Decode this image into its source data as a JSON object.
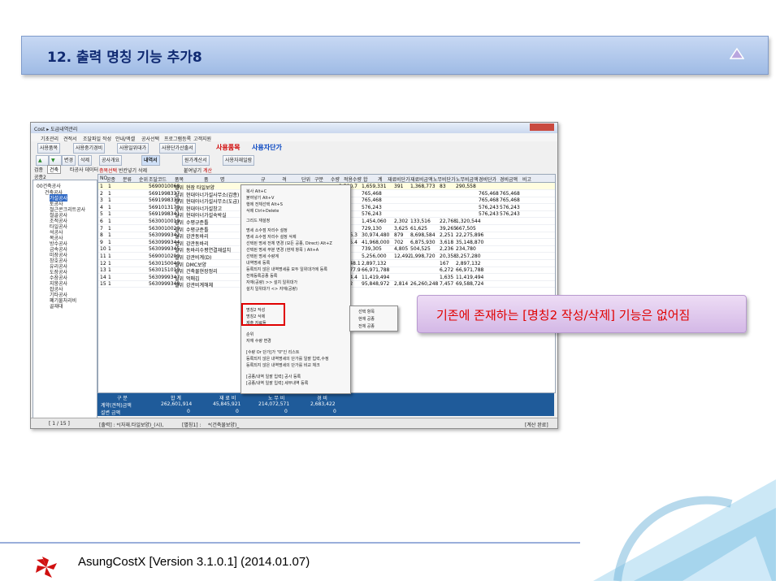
{
  "slide": {
    "title": "12. 출력 명칭 기능 추가8",
    "callout": "기존에 존재하는 [명칭2 작성/삭제] 기능은 없어짐",
    "footer": "AsungCostX    [Version 3.1.0.1]    (2014.01.07)"
  },
  "app": {
    "window_title": "Cost ▸ 도급내역관리",
    "menu": [
      "기초관리",
      "견적서",
      "조달파일 작성",
      "안내/액셀",
      "공사선택",
      "프로그램등록",
      "고객지원"
    ],
    "toolbar": {
      "item1": "사용품목",
      "item2": "사용중기경비",
      "item3": "사용일위대가",
      "item4": "사용단가산출서",
      "red": "사용품목",
      "blue": "사용자단가"
    },
    "toolbar2": {
      "prev": "공사개요",
      "active": "내역서",
      "calc": "원가계산서",
      "docs": "사용자재일람"
    },
    "left_buttons": [
      "변경",
      "삭제"
    ],
    "left_filter": {
      "label": "검종",
      "select": "건축",
      "link": "타공사 데이터"
    },
    "left_label": "공종2",
    "tabs": [
      "층목선택",
      "빈칸넣기",
      "삭제",
      "붙여넣기",
      "계산"
    ],
    "tree_root": "00건축공사",
    "tree_sub": "건축공사",
    "tree": [
      "가설공사",
      "토공사",
      "철근콘크리트공사",
      "철골공사",
      "조적공사",
      "타일공사",
      "석공사",
      "목공사",
      "방수공사",
      "금속공사",
      "미장공사",
      "창호공사",
      "유리공사",
      "도장공사",
      "수장공사",
      "지붕공사",
      "잡공사",
      "기타공사",
      "폐기물처리비",
      "골재대"
    ],
    "grid_headers": [
      "NO",
      "공종",
      "분류",
      "순위",
      "조달코드",
      "품목",
      "품",
      "명",
      "규",
      "격",
      "단위",
      "구분",
      "수량",
      "적용수량",
      "합",
      "계",
      "재료비단가",
      "재료비금액",
      "노무비단가",
      "노무비금액",
      "경비단가",
      "경비금액",
      "비고"
    ],
    "rows": [
      {
        "no": "1",
        "a": "1",
        "code": "5690010068",
        "kind": "일위",
        "name": "현장 타일보양",
        "qty": "3,500.7",
        "amt": "1,659,331",
        "m1": "391",
        "m2": "1,368,773",
        "l1": "83",
        "l2": "290,558",
        "e1": "",
        "e2": ""
      },
      {
        "no": "2",
        "a": "1",
        "code": "5691998337",
        "kind": "일위",
        "name": "현대아너가설사무소(갑종)",
        "qty": "1",
        "amt": "765,468",
        "m1": "",
        "m2": "",
        "l1": "",
        "l2": "",
        "e1": "765,468",
        "e2": "765,468"
      },
      {
        "no": "3",
        "a": "1",
        "code": "5691998339",
        "kind": "일위",
        "name": "현대아너가설사무소(도급)",
        "qty": "1",
        "amt": "765,468",
        "m1": "",
        "m2": "",
        "l1": "",
        "l2": "",
        "e1": "765,468",
        "e2": "765,468"
      },
      {
        "no": "4",
        "a": "1",
        "code": "5691013170",
        "kind": "일위",
        "name": "현대아너가설창고",
        "qty": "1",
        "amt": "576,243",
        "m1": "",
        "m2": "",
        "l1": "",
        "l2": "",
        "e1": "576,243",
        "e2": "576,243"
      },
      {
        "no": "5",
        "a": "1",
        "code": "5691998341",
        "kind": "일위",
        "name": "현대아너가설숙박실",
        "qty": "1",
        "amt": "576,243",
        "m1": "",
        "m2": "",
        "l1": "",
        "l2": "",
        "e1": "576,243",
        "e2": "576,243"
      },
      {
        "no": "6",
        "a": "1",
        "code": "5630010019",
        "kind": "일위",
        "name": "수평규준틀",
        "qty": "58",
        "amt": "1,454,060",
        "m1": "2,302",
        "m2": "133,516",
        "l1": "22,768",
        "l2": "1,320,544",
        "e1": "",
        "e2": ""
      },
      {
        "no": "7",
        "a": "1",
        "code": "5630010020",
        "kind": "일위",
        "name": "수평규준틀",
        "qty": "17",
        "amt": "729,130",
        "m1": "3,625",
        "m2": "61,625",
        "l1": "39,265",
        "l2": "667,505",
        "e1": "",
        "e2": ""
      },
      {
        "no": "8",
        "a": "1",
        "code": "5630999342",
        "kind": "일위",
        "name": "강관동바리",
        "qty": "9,896.3",
        "amt": "30,974,480",
        "m1": "879",
        "m2": "8,698,584",
        "l1": "2,251",
        "l2": "22,275,896",
        "e1": "",
        "e2": ""
      },
      {
        "no": "9",
        "a": "1",
        "code": "5630999344",
        "kind": "일위",
        "name": "강관동바리",
        "qty": "9,775.4",
        "amt": "41,968,000",
        "m1": "702",
        "m2": "6,875,930",
        "l1": "3,618",
        "l2": "35,148,870",
        "e1": "",
        "e2": ""
      },
      {
        "no": "10",
        "a": "1",
        "code": "5630999345",
        "kind": "일위",
        "name": "동바리수평연결재설치",
        "qty": "105",
        "amt": "739,305",
        "m1": "4,805",
        "m2": "504,525",
        "l1": "2,236",
        "l2": "234,780",
        "e1": "",
        "e2": ""
      },
      {
        "no": "11",
        "a": "1",
        "code": "5690010200",
        "kind": "일위",
        "name": "강관비계(D)",
        "qty": "160",
        "amt": "5,256,000",
        "m1": "12,492",
        "m2": "1,998,720",
        "l1": "20,358",
        "l2": "3,257,280",
        "e1": "",
        "e2": ""
      },
      {
        "no": "12",
        "a": "1",
        "code": "5630150040",
        "kind": "일위",
        "name": "DMC보양",
        "qty": "17,348.1",
        "amt": "2,897,132",
        "m1": "",
        "m2": "",
        "l1": "167",
        "l2": "2,897,132",
        "e1": "",
        "e2": ""
      },
      {
        "no": "13",
        "a": "1",
        "code": "5630151010",
        "kind": "일위",
        "name": "건축물현장정리",
        "qty": "13,677.9",
        "amt": "66,971,788",
        "m1": "",
        "m2": "",
        "l1": "6,272",
        "l2": "66,971,788",
        "e1": "",
        "e2": ""
      },
      {
        "no": "14",
        "a": "1",
        "code": "5630999347",
        "kind": "일위",
        "name": "먹매김",
        "qty": "6,984.4",
        "amt": "11,419,494",
        "m1": "",
        "m2": "",
        "l1": "1,635",
        "l2": "11,419,494",
        "e1": "",
        "e2": ""
      },
      {
        "no": "15",
        "a": "1",
        "code": "5630999348",
        "kind": "일위",
        "name": "강관비계해체",
        "qty": "9,332",
        "amt": "95,848,972",
        "m1": "2,814",
        "m2": "26,260,248",
        "l1": "7,457",
        "l2": "69,588,724",
        "e1": "",
        "e2": ""
      }
    ],
    "sum_headers": [
      "구  분",
      "합  계",
      "재 료 비",
      "노 무 비",
      "경  비"
    ],
    "sum_row1": {
      "label": "계약(견적)금액",
      "total": "262,601,914",
      "mat": "45,845,921",
      "lab": "214,072,571",
      "exp": "2,683,422"
    },
    "sum_row2": {
      "label": "설변    금액",
      "total": "0",
      "mat": "0",
      "lab": "0",
      "exp": "0"
    },
    "status": {
      "page": "[  1 / 15  ]",
      "s1": "[출력] : *(자재.타일보양)_(시),",
      "s2": "[별칭1] :",
      "s3": "*(건축물보양)_",
      "s4": "[계산 완료]"
    },
    "context_menu": [
      "복사 Alt+C",
      "붙여넣기 Alt+V",
      "행에 전체선택 Alt+S",
      "삭제 Ctrl+Delete",
      "그리드 재설정",
      "명세 소수점 자리수 설정",
      "명세 소수점 자리수 설정 삭제",
      "선택된 명세 전체 변경 (모든 공종, Direct) Alt+Z",
      "선택된 명세 부분 변경 (현재 항목    ) Alt+A",
      "선택된 명세 수량계",
      "내역명세 등록",
      "등록되지 않은 내역명세를 모두 일위대가에 등록",
      "전체등록공종 등록",
      "자재(공량) >> 설치 일위대가",
      "설치 일위대가 <> 자재(공량)",
      "명칭2 작성",
      "명칭2 삭제",
      "제출 자료들",
      "순위",
      "자재 수량 변경",
      "[수량 Or 단가]가 \"0\"인 리스트",
      "등록되지 않은 내역명세의 단가를 일괄 입력,수정",
      "등록되지 않은 내역명세의 단가를 비교 체크",
      "[공종/내역 일괄 입력] 공사 등록",
      "[공종/내역 일괄 입력] 세부내역 등록"
    ],
    "submenu": [
      "선택 항목",
      "현재 공종",
      "전체 공종"
    ]
  },
  "colors": {
    "accent": "#102a72",
    "callout_text": "#e00000",
    "sum_bar": "#1f5b9a"
  }
}
